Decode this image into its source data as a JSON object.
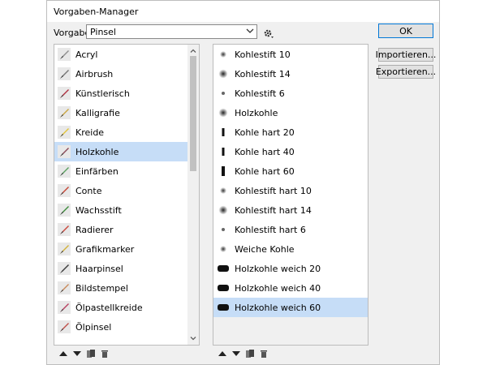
{
  "window": {
    "title": "Vorgaben-Manager"
  },
  "preset": {
    "label": "Vorgabe:",
    "value": "Pinsel"
  },
  "buttons": {
    "ok": "OK",
    "import": "Importieren...",
    "export": "Exportieren..."
  },
  "left_list": [
    {
      "label": "Acryl",
      "icon": "acrylic-brush-icon",
      "color": "#8e8e8e"
    },
    {
      "label": "Airbrush",
      "icon": "airbrush-icon",
      "color": "#777777"
    },
    {
      "label": "Künstlerisch",
      "icon": "artistic-brush-icon",
      "color": "#b03040"
    },
    {
      "label": "Kalligrafie",
      "icon": "calligraphy-pen-icon",
      "color": "#c9a640"
    },
    {
      "label": "Kreide",
      "icon": "chalk-icon",
      "color": "#e2c43a"
    },
    {
      "label": "Holzkohle",
      "icon": "charcoal-icon",
      "color": "#8b4a58",
      "selected": true
    },
    {
      "label": "Einfärben",
      "icon": "colorize-icon",
      "color": "#5ba060"
    },
    {
      "label": "Conte",
      "icon": "conte-crayon-icon",
      "color": "#c54534"
    },
    {
      "label": "Wachsstift",
      "icon": "wax-crayon-icon",
      "color": "#3e8c3c"
    },
    {
      "label": "Radierer",
      "icon": "eraser-icon",
      "color": "#c9473b"
    },
    {
      "label": "Grafikmarker",
      "icon": "graphic-marker-icon",
      "color": "#d2b23a"
    },
    {
      "label": "Haarpinsel",
      "icon": "hair-brush-icon",
      "color": "#3a3a3a"
    },
    {
      "label": "Bildstempel",
      "icon": "image-stamp-icon",
      "color": "#c98a5a"
    },
    {
      "label": "Ölpastellkreide",
      "icon": "oil-pastel-icon",
      "color": "#b84060"
    },
    {
      "label": "Ölpinsel",
      "icon": "oil-brush-icon",
      "color": "#c0504a"
    }
  ],
  "right_list": [
    {
      "label": "Kohlestift 10",
      "icon": "soft-round-small-icon"
    },
    {
      "label": "Kohlestift 14",
      "icon": "soft-round-medium-icon"
    },
    {
      "label": "Kohlestift 6",
      "icon": "soft-round-tiny-icon"
    },
    {
      "label": "Holzkohle",
      "icon": "soft-round-medium-icon"
    },
    {
      "label": "Kohle hart 20",
      "icon": "hard-bar-icon"
    },
    {
      "label": "Kohle hart 40",
      "icon": "hard-bar-icon"
    },
    {
      "label": "Kohle hart 60",
      "icon": "hard-bar-tall-icon"
    },
    {
      "label": "Kohlestift hart 10",
      "icon": "soft-round-small-icon"
    },
    {
      "label": "Kohlestift hart 14",
      "icon": "soft-round-medium-icon"
    },
    {
      "label": "Kohlestift hart 6",
      "icon": "soft-round-tiny-icon"
    },
    {
      "label": "Weiche Kohle",
      "icon": "soft-round-small-icon"
    },
    {
      "label": "Holzkohle weich 20",
      "icon": "wide-blob-icon"
    },
    {
      "label": "Holzkohle weich 40",
      "icon": "wide-blob-icon"
    },
    {
      "label": "Holzkohle weich 60",
      "icon": "wide-blob-icon",
      "selected": true
    }
  ]
}
